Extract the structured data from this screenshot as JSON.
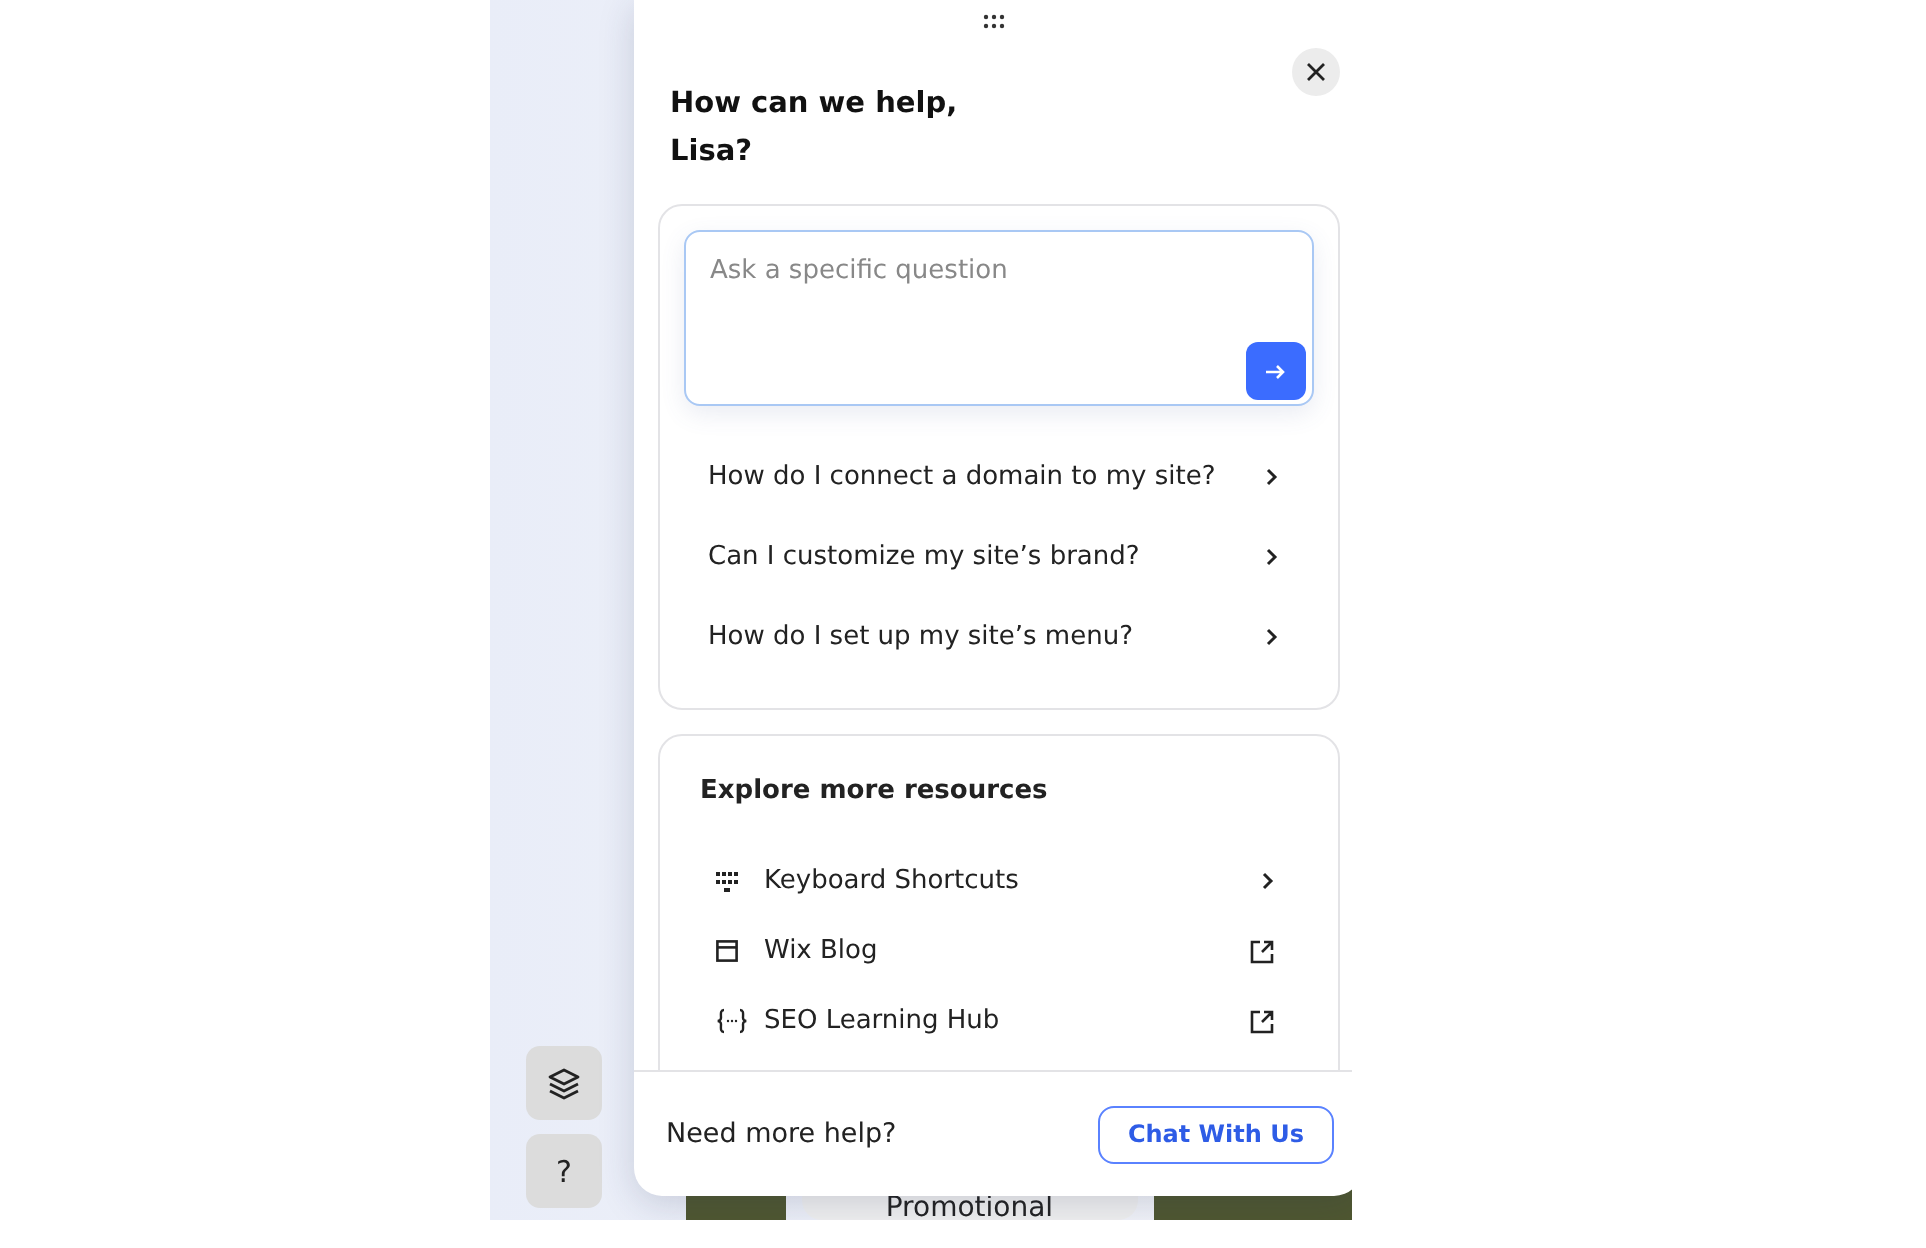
{
  "background": {
    "tag": "Promotional"
  },
  "help_panel": {
    "title": "How can we help, Lisa?",
    "search": {
      "placeholder": "Ask a specific question"
    },
    "suggestions": [
      {
        "label": "How do I connect a domain to my site?"
      },
      {
        "label": "Can I customize my site’s brand?"
      },
      {
        "label": "How do I set up my site’s menu?"
      }
    ],
    "resources": {
      "title": "Explore more resources",
      "items": [
        {
          "label": "Keyboard Shortcuts",
          "kind": "keyboard",
          "external": false
        },
        {
          "label": "Wix Blog",
          "kind": "blog",
          "external": true
        },
        {
          "label": "SEO Learning Hub",
          "kind": "code",
          "external": true
        }
      ]
    },
    "footer": {
      "text": "Need more help?",
      "button": "Chat With Us"
    }
  },
  "toolbar": [
    {
      "kind": "layers"
    },
    {
      "kind": "help",
      "label": "?"
    }
  ]
}
